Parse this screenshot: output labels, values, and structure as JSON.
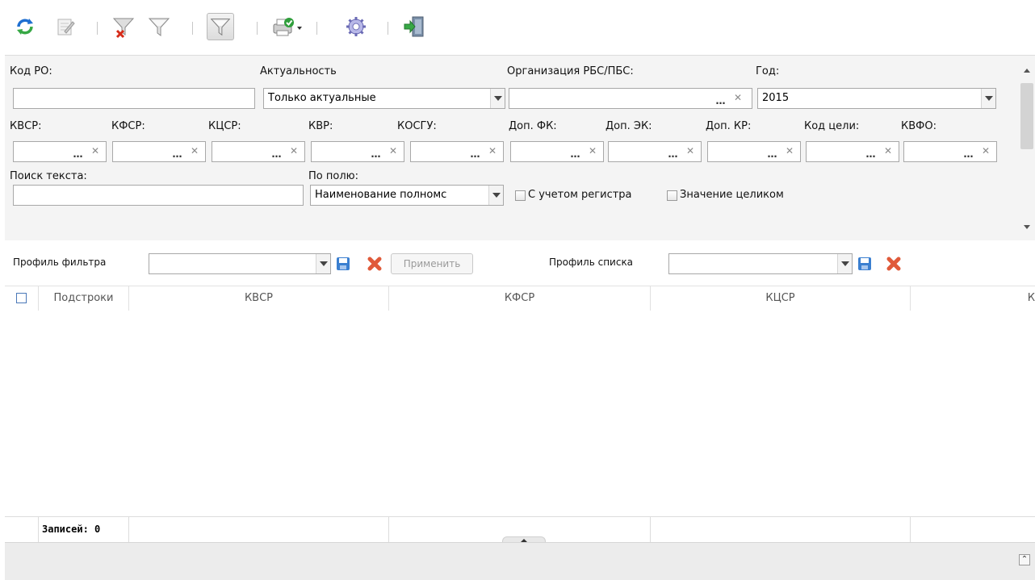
{
  "toolbar": {
    "buttons": [
      {
        "name": "refresh-icon"
      },
      {
        "name": "edit-icon"
      },
      {
        "name": "clear-filter-icon"
      },
      {
        "name": "filter-icon"
      },
      {
        "name": "filter-toggle-icon",
        "pressed": true
      },
      {
        "name": "print-icon"
      },
      {
        "name": "settings-icon"
      },
      {
        "name": "exit-icon"
      }
    ]
  },
  "filter": {
    "kod_ro_label": "Код РО:",
    "kod_ro_value": "",
    "aktualnost_label": "Актуальность",
    "aktualnost_value": "Только актуальные",
    "org_label": "Организация РБС/ПБС:",
    "org_value": "",
    "god_label": "Год:",
    "god_value": "2015",
    "codes": [
      {
        "label": "КВСР:"
      },
      {
        "label": "КФСР:"
      },
      {
        "label": "КЦСР:"
      },
      {
        "label": "КВР:"
      },
      {
        "label": "КОСГУ:"
      },
      {
        "label": "Доп. ФК:"
      },
      {
        "label": "Доп. ЭК:"
      },
      {
        "label": "Доп. КР:"
      },
      {
        "label": "Код цели:"
      },
      {
        "label": "КВФО:"
      }
    ],
    "search_label": "Поиск текста:",
    "search_value": "",
    "field_label": "По полю:",
    "field_value": "Наименование полномс",
    "case_label": "С учетом регистра",
    "whole_label": "Значение целиком"
  },
  "profile": {
    "filter_label": "Профиль фильтра",
    "filter_value": "",
    "apply_label": "Применить",
    "list_label": "Профиль списка",
    "list_value": ""
  },
  "grid": {
    "columns": [
      "Подстроки",
      "КВСР",
      "КФСР",
      "КЦСР",
      "К"
    ],
    "footer_label": "Записей: 0"
  },
  "colors": {
    "panel": "#f4f4f4",
    "border": "#a8a8a8",
    "save_icon": "#3b7fd0",
    "delete_icon": "#e05a3a"
  }
}
